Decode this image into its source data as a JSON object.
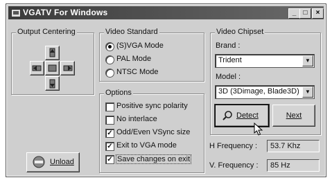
{
  "window": {
    "title": "VGATV For Windows",
    "minimize": "_",
    "maximize": "□",
    "close": "×"
  },
  "output_centering": {
    "label": "Output Centering"
  },
  "unload_button": {
    "label": "Unload"
  },
  "video_standard": {
    "label": "Video Standard",
    "options": [
      "(S)VGA Mode",
      "PAL Mode",
      "NTSC Mode"
    ],
    "selected_index": 0
  },
  "options": {
    "label": "Options",
    "items": [
      {
        "label": "Positive sync polarity",
        "checked": false
      },
      {
        "label": "No interlace",
        "checked": false
      },
      {
        "label": "Odd/Even VSync size",
        "checked": true
      },
      {
        "label": "Exit to VGA mode",
        "checked": true
      },
      {
        "label": "Save changes on exit",
        "checked": true
      }
    ]
  },
  "video_chipset": {
    "label": "Video Chipset",
    "brand_label": "Brand :",
    "brand_value": "Trident",
    "model_label": "Model :",
    "model_value": "3D (3Dimage, Blade3D)",
    "detect_label": "Detect",
    "next_label": "Next"
  },
  "frequencies": {
    "h_label": "H Frequency :",
    "h_value": "53.7 Khz",
    "v_label": "V. Frequency :",
    "v_value": "85 Hz"
  }
}
